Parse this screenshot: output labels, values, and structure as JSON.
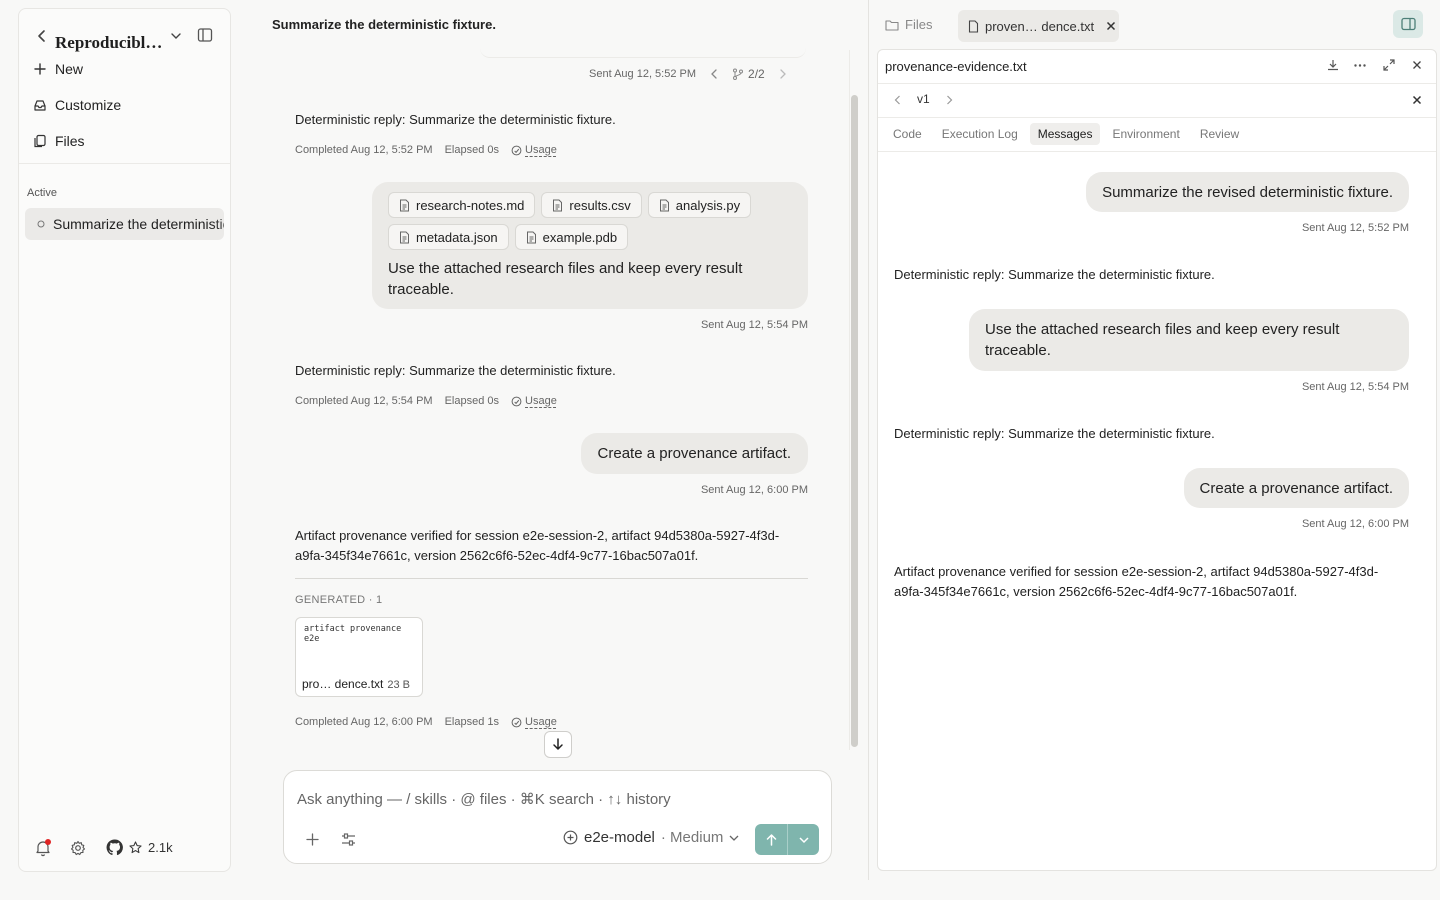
{
  "sidebar": {
    "title": "Reproducibl…",
    "new_label": "New",
    "customize_label": "Customize",
    "files_label": "Files",
    "section_label": "Active",
    "active_session": "Summarize the deterministic fixture.",
    "github_stars": "2.1k"
  },
  "chat": {
    "title": "Summarize the deterministic fixture.",
    "top_meta": "Sent Aug 12, 5:52 PM",
    "branch": "2/2",
    "messages": [
      {
        "reply": "Deterministic reply: Summarize the deterministic fixture.",
        "completed": "Completed Aug 12, 5:52 PM",
        "elapsed": "Elapsed 0s",
        "usage": "Usage"
      },
      {
        "reply": "Deterministic reply: Summarize the deterministic fixture.",
        "completed": "Completed Aug 12, 5:54 PM",
        "elapsed": "Elapsed 0s",
        "usage": "Usage"
      }
    ],
    "user2": {
      "attachments": [
        "research-notes.md",
        "results.csv",
        "analysis.py",
        "metadata.json",
        "example.pdb"
      ],
      "text": "Use the attached research files and keep every result traceable.",
      "sent": "Sent Aug 12, 5:54 PM"
    },
    "user3": {
      "text": "Create a provenance artifact.",
      "sent": "Sent Aug 12, 6:00 PM"
    },
    "final": {
      "text": "Artifact provenance verified for session e2e-session-2, artifact 94d5380a-5927-4f3d-a9fa-345f34e7661c, version 2562c6f6-52ec-4df4-9c77-16bac507a01f.",
      "generated_label": "GENERATED · 1",
      "card_preview": "artifact provenance e2e",
      "card_name": "pro… dence.txt",
      "card_size": "23 B",
      "completed": "Completed Aug 12, 6:00 PM",
      "elapsed": "Elapsed 1s",
      "usage": "Usage"
    }
  },
  "composer": {
    "placeholder": "Ask anything — / skills · @ files · ⌘K search · ↑↓ history",
    "model": "e2e-model",
    "effort": "· Medium"
  },
  "right_panel": {
    "files_tab": "Files",
    "open_tab": "proven… dence.txt",
    "file_name": "provenance-evidence.txt",
    "version": "v1",
    "tabs": [
      "Code",
      "Execution Log",
      "Messages",
      "Environment",
      "Review"
    ],
    "active_tab": "Messages",
    "messages": {
      "u1": "Summarize the revised deterministic fixture.",
      "u1_sent": "Sent Aug 12, 5:52 PM",
      "a1": "Deterministic reply: Summarize the deterministic fixture.",
      "u2": "Use the attached research files and keep every result traceable.",
      "u2_sent": "Sent Aug 12, 5:54 PM",
      "a2": "Deterministic reply: Summarize the deterministic fixture.",
      "u3": "Create a provenance artifact.",
      "u3_sent": "Sent Aug 12, 6:00 PM",
      "a3": "Artifact provenance verified for session e2e-session-2, artifact 94d5380a-5927-4f3d-a9fa-345f34e7661c, version 2562c6f6-52ec-4df4-9c77-16bac507a01f."
    }
  },
  "colors": {
    "accent": "#7fb5ad",
    "notification": "#e02424",
    "bubble": "#ebeae7"
  }
}
